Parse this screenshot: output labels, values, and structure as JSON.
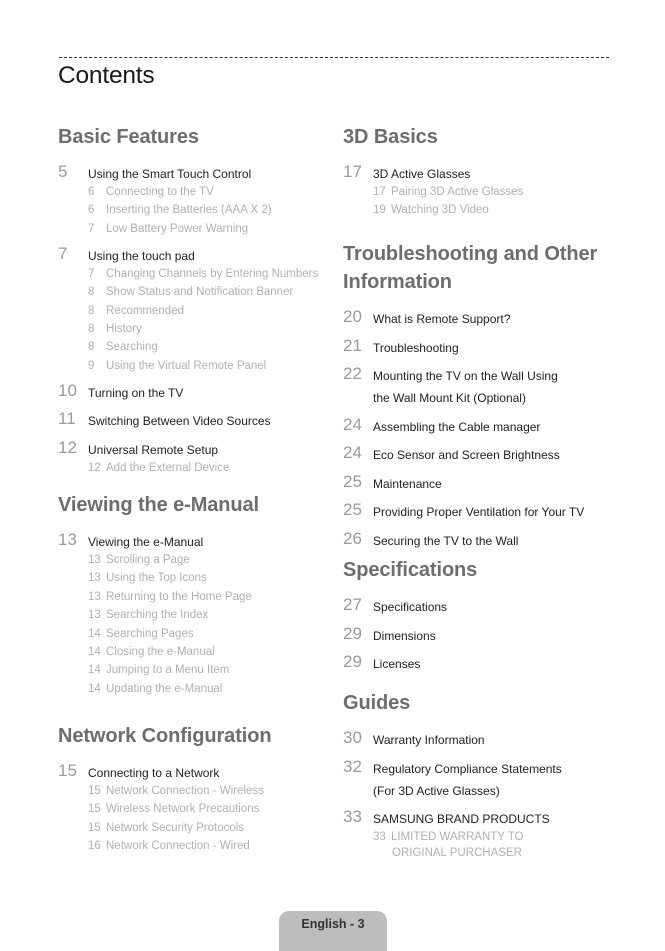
{
  "page": {
    "title": "Contents",
    "footer": "English - 3"
  },
  "left": [
    {
      "heading": "Basic Features",
      "entries": [
        {
          "page": "5",
          "label": "Using the Smart Touch Control",
          "subs": [
            {
              "page": "6",
              "label": "Connecting to the TV"
            },
            {
              "page": "6",
              "label": "Inserting the Batteries (AAA X 2)"
            },
            {
              "page": "7",
              "label": "Low Battery Power Warning"
            }
          ]
        },
        {
          "page": "7",
          "label": "Using the touch pad",
          "subs": [
            {
              "page": "7",
              "label": "Changing Channels by Entering Numbers"
            },
            {
              "page": "8",
              "label": "Show Status and Notification Banner"
            },
            {
              "page": "8",
              "label": "Recommended"
            },
            {
              "page": "8",
              "label": "History"
            },
            {
              "page": "8",
              "label": "Searching"
            },
            {
              "page": "9",
              "label": "Using the Virtual Remote Panel"
            }
          ]
        },
        {
          "page": "10",
          "label": "Turning on the TV",
          "subs": []
        },
        {
          "page": "11",
          "label": "Switching Between Video Sources",
          "subs": []
        },
        {
          "page": "12",
          "label": "Universal Remote Setup",
          "subs": [
            {
              "page": "12",
              "label": "Add the External Device"
            }
          ]
        }
      ]
    },
    {
      "heading": "Viewing the e-Manual",
      "entries": [
        {
          "page": "13",
          "label": "Viewing the e-Manual",
          "subs": [
            {
              "page": "13",
              "label": "Scrolling a Page"
            },
            {
              "page": "13",
              "label": "Using the Top Icons"
            },
            {
              "page": "13",
              "label": "Returning to the Home Page"
            },
            {
              "page": "13",
              "label": "Searching the Index"
            },
            {
              "page": "14",
              "label": "Searching Pages"
            },
            {
              "page": "14",
              "label": "Closing the e-Manual"
            },
            {
              "page": "14",
              "label": "Jumping to a Menu Item"
            },
            {
              "page": "14",
              "label": "Updating the e-Manual"
            }
          ]
        }
      ]
    },
    {
      "heading": "Network Configuration",
      "entries": [
        {
          "page": "15",
          "label": "Connecting to a Network",
          "subs": [
            {
              "page": "15",
              "label": "Network Connection - Wireless"
            },
            {
              "page": "15",
              "label": "Wireless Network Precautions"
            },
            {
              "page": "15",
              "label": "Network Security Protocols"
            },
            {
              "page": "16",
              "label": "Network Connection - Wired"
            }
          ]
        }
      ]
    }
  ],
  "right": [
    {
      "heading": "3D Basics",
      "entries": [
        {
          "page": "17",
          "label": "3D Active Glasses",
          "subs": [
            {
              "page": "17",
              "label": "Pairing 3D Active Glasses"
            },
            {
              "page": "19",
              "label": "Watching 3D Video"
            }
          ]
        }
      ]
    },
    {
      "heading": "Troubleshooting and Other Information",
      "entries": [
        {
          "page": "20",
          "label": "What is Remote Support?",
          "subs": []
        },
        {
          "page": "21",
          "label": "Troubleshooting",
          "subs": []
        },
        {
          "page": "22",
          "label": "Mounting the TV on the Wall Using",
          "label2": "the Wall Mount Kit (Optional)",
          "subs": []
        },
        {
          "page": "24",
          "label": "Assembling the Cable manager",
          "subs": []
        },
        {
          "page": "24",
          "label": "Eco Sensor and Screen Brightness",
          "subs": []
        },
        {
          "page": "25",
          "label": "Maintenance",
          "subs": []
        },
        {
          "page": "25",
          "label": "Providing Proper Ventilation for Your TV",
          "subs": []
        },
        {
          "page": "26",
          "label": "Securing the TV to the Wall",
          "subs": []
        }
      ]
    },
    {
      "heading": "Specifications",
      "entries": [
        {
          "page": "27",
          "label": "Specifications",
          "subs": []
        },
        {
          "page": "29",
          "label": "Dimensions",
          "subs": []
        },
        {
          "page": "29",
          "label": "Licenses",
          "subs": []
        }
      ]
    },
    {
      "heading": "Guides",
      "entries": [
        {
          "page": "30",
          "label": "Warranty Information",
          "subs": []
        },
        {
          "page": "32",
          "label": "Regulatory Compliance Statements",
          "label2": "(For 3D Active Glasses)",
          "subs": []
        },
        {
          "page": "33",
          "label": "SAMSUNG BRAND PRODUCTS",
          "subs": [
            {
              "page": "33",
              "label": "LIMITED WARRANTY TO",
              "label2": "ORIGINAL PURCHASER"
            }
          ]
        }
      ]
    }
  ]
}
